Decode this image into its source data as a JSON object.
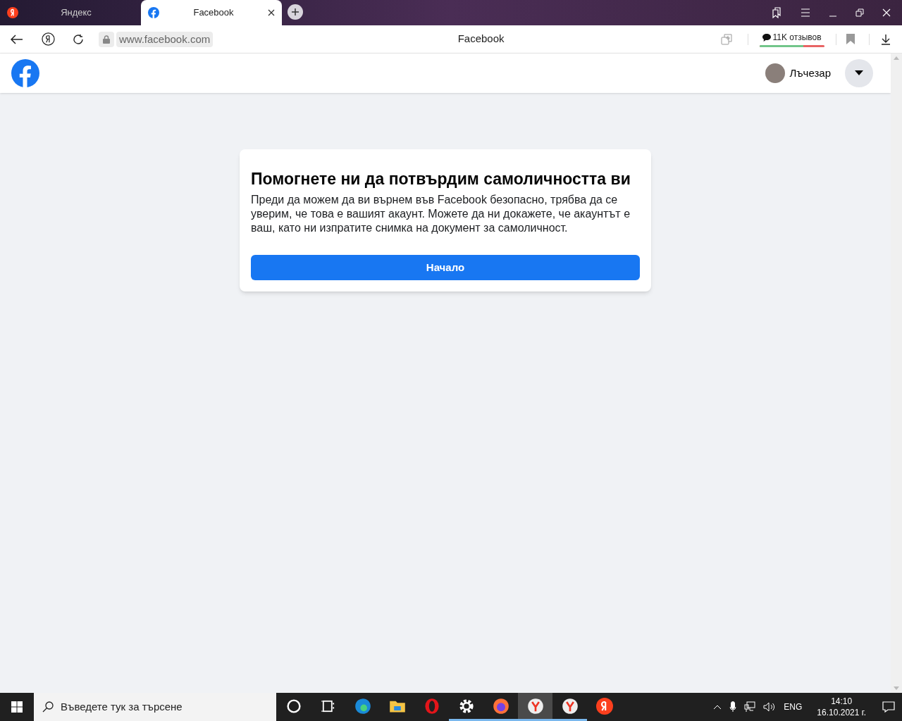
{
  "browser": {
    "tabs": [
      {
        "label": "Яндекс",
        "selected": false
      },
      {
        "label": "Facebook",
        "selected": true
      }
    ],
    "address": "www.facebook.com",
    "page_title": "Facebook",
    "reviews": {
      "label": "11K отзывов",
      "level": 0.67
    }
  },
  "header": {
    "user_name": "Лъчезар"
  },
  "card": {
    "title": "Помогнете ни да потвърдим самоличността ви",
    "text": "Преди да можем да ви върнем във Facebook безопасно, трябва да се уверим, че това е вашият акаунт. Можете да ни докажете, че акаунтът е ваш, като ни изпратите снимка на документ за самоличност.",
    "button": "Начало"
  },
  "taskbar": {
    "search_placeholder": "Въведете тук за търсене",
    "apps": [
      {
        "kind": "cortana",
        "running": false,
        "selected": false
      },
      {
        "kind": "taskview",
        "running": false,
        "selected": false
      },
      {
        "kind": "edge",
        "running": false,
        "selected": false
      },
      {
        "kind": "explorer",
        "running": false,
        "selected": false
      },
      {
        "kind": "opera",
        "running": false,
        "selected": false
      },
      {
        "kind": "settings",
        "running": true,
        "selected": false
      },
      {
        "kind": "firefox",
        "running": true,
        "selected": false
      },
      {
        "kind": "yabrowser",
        "running": true,
        "selected": true
      },
      {
        "kind": "yabrowser",
        "running": true,
        "selected": false
      },
      {
        "kind": "yandex",
        "running": false,
        "selected": false
      }
    ],
    "language": "ENG",
    "time": "14:10",
    "date": "16.10.2021 г."
  }
}
